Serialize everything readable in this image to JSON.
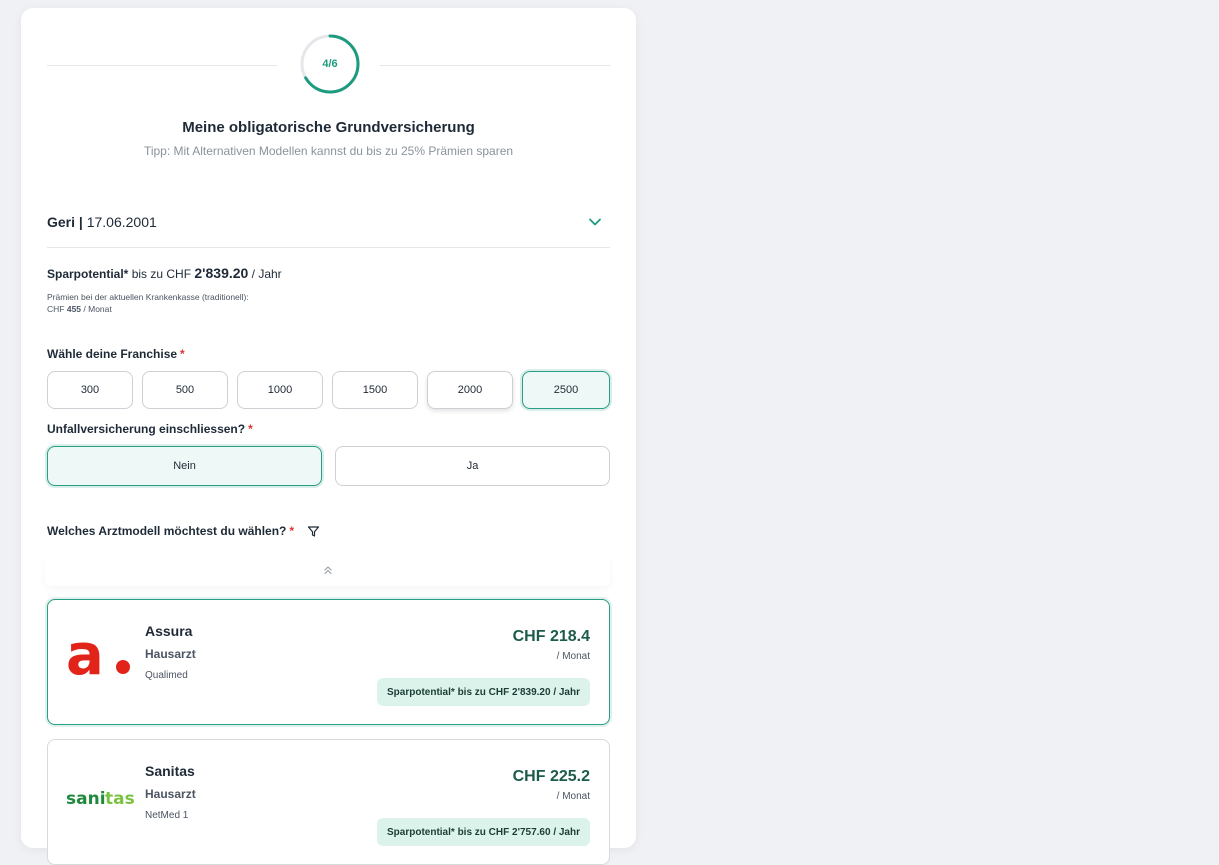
{
  "progress": {
    "label": "4/6",
    "current": 4,
    "total": 6
  },
  "header": {
    "title": "Meine obligatorische Grundversicherung",
    "tip": "Tipp: Mit Alternativen Modellen kannst du bis zu 25% Prämien sparen"
  },
  "person": {
    "name": "Geri",
    "separator": " | ",
    "birthdate": "17.06.2001"
  },
  "savings": {
    "label": "Sparpotential*",
    "prefix": " bis zu CHF ",
    "amount": "2'839.20",
    "suffix": " / Jahr"
  },
  "current_premium": {
    "line1": "Prämien bei der aktuellen Krankenkasse (traditionell):",
    "currency": "CHF ",
    "amount": "455",
    "suffix": " / Monat"
  },
  "franchise": {
    "label": "Wähle deine Franchise",
    "required": "*",
    "options": [
      "300",
      "500",
      "1000",
      "1500",
      "2000",
      "2500"
    ],
    "selected": "2500"
  },
  "accident": {
    "label": "Unfallversicherung einschliessen?",
    "required": "*",
    "options": [
      "Nein",
      "Ja"
    ],
    "selected": "Nein"
  },
  "doctor_model": {
    "label": "Welches Arztmodell möchtest du wählen?",
    "required": "*"
  },
  "offers": [
    {
      "insurer": "Assura",
      "logo_text": "a.",
      "model": "Hausarzt",
      "product": "Qualimed",
      "price": "CHF 218.4",
      "per": "/ Monat",
      "savings": "Sparpotential* bis zu CHF 2'839.20 / Jahr"
    },
    {
      "insurer": "Sanitas",
      "logo_text": "sanitas",
      "model": "Hausarzt",
      "product": "NetMed 1",
      "price": "CHF 225.2",
      "per": "/ Monat",
      "savings": "Sparpotential* bis zu CHF 2'757.60 / Jahr"
    }
  ],
  "colors": {
    "accent": "#1d9b7f",
    "selected_bg": "#eef8f6",
    "price": "#1c5b4b",
    "pill_bg": "#dcf3ec",
    "assura_red": "#e2231a",
    "sanitas_green": "#1f8a3c"
  }
}
